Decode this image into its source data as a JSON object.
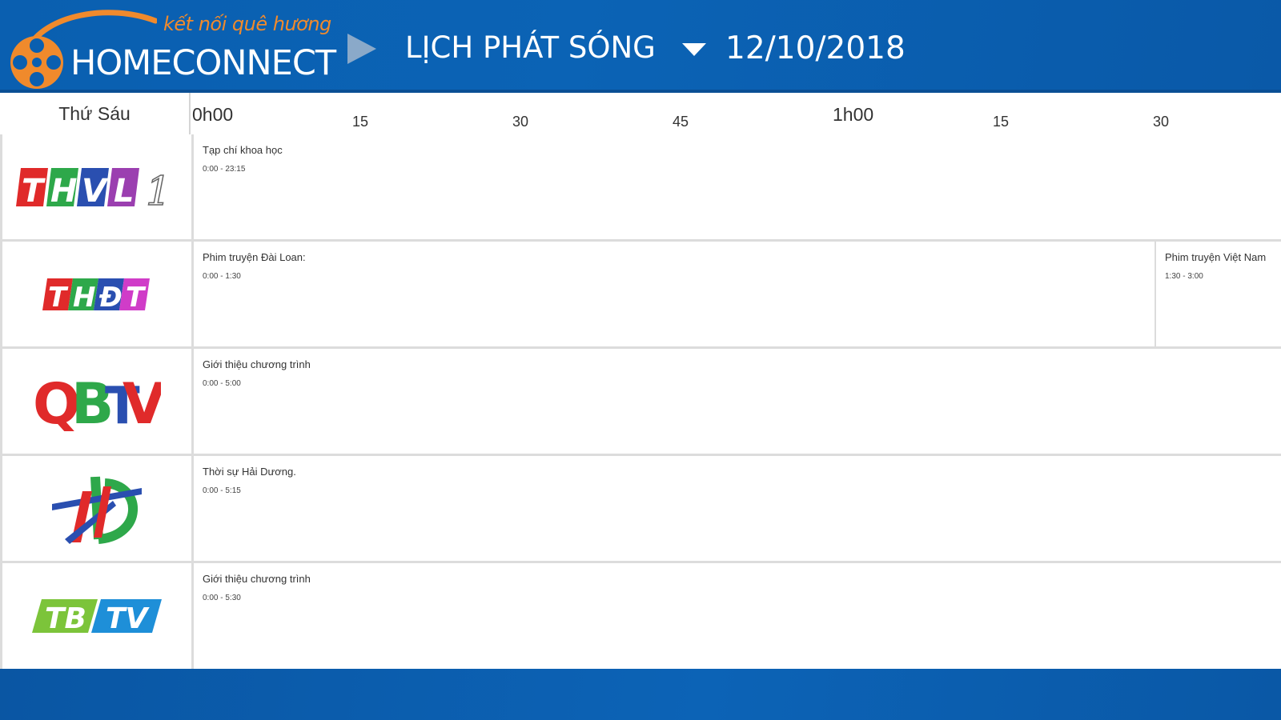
{
  "header": {
    "logo_tagline": "kết nối quê hương",
    "logo_name": "HOMECONNECT",
    "title": "LỊCH PHÁT SÓNG",
    "date": "12/10/2018",
    "colors": {
      "bar": "#0a5fb0",
      "logo_accent": "#f08a2c"
    }
  },
  "timeline": {
    "day": "Thứ Sáu",
    "ticks": [
      "0h00",
      "15",
      "30",
      "45",
      "1h00",
      "15",
      "30"
    ]
  },
  "channels": [
    {
      "logo_text": "THVL 1",
      "logo_icon": "thvl1-logo",
      "programs": [
        {
          "title": "Tạp chí khoa học",
          "time": "0:00 - 23:15"
        }
      ]
    },
    {
      "logo_text": "THĐT",
      "logo_icon": "thdt-logo",
      "programs": [
        {
          "title": "Phim truyện Đài Loan:",
          "time": "0:00 - 1:30"
        },
        {
          "title": "Phim truyện Việt Nam",
          "time": "1:30 - 3:00"
        }
      ]
    },
    {
      "logo_text": "QBTV",
      "logo_icon": "qbtv-logo",
      "programs": [
        {
          "title": "Giới thiệu chương trình",
          "time": "0:00 - 5:00"
        }
      ]
    },
    {
      "logo_text": "THD",
      "logo_icon": "thd-logo",
      "programs": [
        {
          "title": "Thời sự Hải Dương.",
          "time": "0:00 - 5:15"
        }
      ]
    },
    {
      "logo_text": "TBTV",
      "logo_icon": "tbtv-logo",
      "programs": [
        {
          "title": "Giới thiệu chương trình",
          "time": "0:00 - 5:30"
        }
      ]
    }
  ]
}
